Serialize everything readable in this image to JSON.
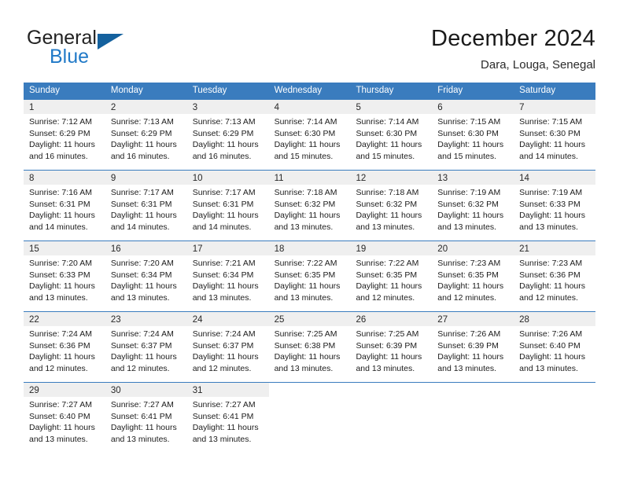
{
  "brand": {
    "line1": "General",
    "line2": "Blue",
    "flag_icon": "blue-flag-triangle",
    "accent_color": "#14619e",
    "blue_text_color": "#2079c7"
  },
  "header": {
    "title": "December 2024",
    "subtitle": "Dara, Louga, Senegal"
  },
  "theme": {
    "header_row_bg": "#3a7cbe",
    "day_number_bg": "#efefef",
    "grid_line": "#3a7cbe",
    "text": "#1c1c1c"
  },
  "weekdays": [
    "Sunday",
    "Monday",
    "Tuesday",
    "Wednesday",
    "Thursday",
    "Friday",
    "Saturday"
  ],
  "weeks": [
    [
      {
        "day": "1",
        "sunrise": "Sunrise: 7:12 AM",
        "sunset": "Sunset: 6:29 PM",
        "daylight": "Daylight: 11 hours and 16 minutes."
      },
      {
        "day": "2",
        "sunrise": "Sunrise: 7:13 AM",
        "sunset": "Sunset: 6:29 PM",
        "daylight": "Daylight: 11 hours and 16 minutes."
      },
      {
        "day": "3",
        "sunrise": "Sunrise: 7:13 AM",
        "sunset": "Sunset: 6:29 PM",
        "daylight": "Daylight: 11 hours and 16 minutes."
      },
      {
        "day": "4",
        "sunrise": "Sunrise: 7:14 AM",
        "sunset": "Sunset: 6:30 PM",
        "daylight": "Daylight: 11 hours and 15 minutes."
      },
      {
        "day": "5",
        "sunrise": "Sunrise: 7:14 AM",
        "sunset": "Sunset: 6:30 PM",
        "daylight": "Daylight: 11 hours and 15 minutes."
      },
      {
        "day": "6",
        "sunrise": "Sunrise: 7:15 AM",
        "sunset": "Sunset: 6:30 PM",
        "daylight": "Daylight: 11 hours and 15 minutes."
      },
      {
        "day": "7",
        "sunrise": "Sunrise: 7:15 AM",
        "sunset": "Sunset: 6:30 PM",
        "daylight": "Daylight: 11 hours and 14 minutes."
      }
    ],
    [
      {
        "day": "8",
        "sunrise": "Sunrise: 7:16 AM",
        "sunset": "Sunset: 6:31 PM",
        "daylight": "Daylight: 11 hours and 14 minutes."
      },
      {
        "day": "9",
        "sunrise": "Sunrise: 7:17 AM",
        "sunset": "Sunset: 6:31 PM",
        "daylight": "Daylight: 11 hours and 14 minutes."
      },
      {
        "day": "10",
        "sunrise": "Sunrise: 7:17 AM",
        "sunset": "Sunset: 6:31 PM",
        "daylight": "Daylight: 11 hours and 14 minutes."
      },
      {
        "day": "11",
        "sunrise": "Sunrise: 7:18 AM",
        "sunset": "Sunset: 6:32 PM",
        "daylight": "Daylight: 11 hours and 13 minutes."
      },
      {
        "day": "12",
        "sunrise": "Sunrise: 7:18 AM",
        "sunset": "Sunset: 6:32 PM",
        "daylight": "Daylight: 11 hours and 13 minutes."
      },
      {
        "day": "13",
        "sunrise": "Sunrise: 7:19 AM",
        "sunset": "Sunset: 6:32 PM",
        "daylight": "Daylight: 11 hours and 13 minutes."
      },
      {
        "day": "14",
        "sunrise": "Sunrise: 7:19 AM",
        "sunset": "Sunset: 6:33 PM",
        "daylight": "Daylight: 11 hours and 13 minutes."
      }
    ],
    [
      {
        "day": "15",
        "sunrise": "Sunrise: 7:20 AM",
        "sunset": "Sunset: 6:33 PM",
        "daylight": "Daylight: 11 hours and 13 minutes."
      },
      {
        "day": "16",
        "sunrise": "Sunrise: 7:20 AM",
        "sunset": "Sunset: 6:34 PM",
        "daylight": "Daylight: 11 hours and 13 minutes."
      },
      {
        "day": "17",
        "sunrise": "Sunrise: 7:21 AM",
        "sunset": "Sunset: 6:34 PM",
        "daylight": "Daylight: 11 hours and 13 minutes."
      },
      {
        "day": "18",
        "sunrise": "Sunrise: 7:22 AM",
        "sunset": "Sunset: 6:35 PM",
        "daylight": "Daylight: 11 hours and 13 minutes."
      },
      {
        "day": "19",
        "sunrise": "Sunrise: 7:22 AM",
        "sunset": "Sunset: 6:35 PM",
        "daylight": "Daylight: 11 hours and 12 minutes."
      },
      {
        "day": "20",
        "sunrise": "Sunrise: 7:23 AM",
        "sunset": "Sunset: 6:35 PM",
        "daylight": "Daylight: 11 hours and 12 minutes."
      },
      {
        "day": "21",
        "sunrise": "Sunrise: 7:23 AM",
        "sunset": "Sunset: 6:36 PM",
        "daylight": "Daylight: 11 hours and 12 minutes."
      }
    ],
    [
      {
        "day": "22",
        "sunrise": "Sunrise: 7:24 AM",
        "sunset": "Sunset: 6:36 PM",
        "daylight": "Daylight: 11 hours and 12 minutes."
      },
      {
        "day": "23",
        "sunrise": "Sunrise: 7:24 AM",
        "sunset": "Sunset: 6:37 PM",
        "daylight": "Daylight: 11 hours and 12 minutes."
      },
      {
        "day": "24",
        "sunrise": "Sunrise: 7:24 AM",
        "sunset": "Sunset: 6:37 PM",
        "daylight": "Daylight: 11 hours and 12 minutes."
      },
      {
        "day": "25",
        "sunrise": "Sunrise: 7:25 AM",
        "sunset": "Sunset: 6:38 PM",
        "daylight": "Daylight: 11 hours and 13 minutes."
      },
      {
        "day": "26",
        "sunrise": "Sunrise: 7:25 AM",
        "sunset": "Sunset: 6:39 PM",
        "daylight": "Daylight: 11 hours and 13 minutes."
      },
      {
        "day": "27",
        "sunrise": "Sunrise: 7:26 AM",
        "sunset": "Sunset: 6:39 PM",
        "daylight": "Daylight: 11 hours and 13 minutes."
      },
      {
        "day": "28",
        "sunrise": "Sunrise: 7:26 AM",
        "sunset": "Sunset: 6:40 PM",
        "daylight": "Daylight: 11 hours and 13 minutes."
      }
    ],
    [
      {
        "day": "29",
        "sunrise": "Sunrise: 7:27 AM",
        "sunset": "Sunset: 6:40 PM",
        "daylight": "Daylight: 11 hours and 13 minutes."
      },
      {
        "day": "30",
        "sunrise": "Sunrise: 7:27 AM",
        "sunset": "Sunset: 6:41 PM",
        "daylight": "Daylight: 11 hours and 13 minutes."
      },
      {
        "day": "31",
        "sunrise": "Sunrise: 7:27 AM",
        "sunset": "Sunset: 6:41 PM",
        "daylight": "Daylight: 11 hours and 13 minutes."
      },
      {
        "day": "",
        "sunrise": "",
        "sunset": "",
        "daylight": ""
      },
      {
        "day": "",
        "sunrise": "",
        "sunset": "",
        "daylight": ""
      },
      {
        "day": "",
        "sunrise": "",
        "sunset": "",
        "daylight": ""
      },
      {
        "day": "",
        "sunrise": "",
        "sunset": "",
        "daylight": ""
      }
    ]
  ]
}
